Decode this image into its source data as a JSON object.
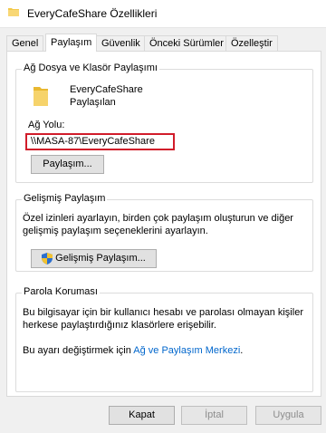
{
  "window": {
    "title": "EveryCafeShare Özellikleri",
    "icon": "folder-icon"
  },
  "tabs": [
    {
      "label": "Genel",
      "active": false
    },
    {
      "label": "Paylaşım",
      "active": true
    },
    {
      "label": "Güvenlik",
      "active": false
    },
    {
      "label": "Önceki Sürümler",
      "active": false
    },
    {
      "label": "Özelleştir",
      "active": false
    }
  ],
  "network_sharing": {
    "legend": "Ağ Dosya ve Klasör Paylaşımı",
    "folder_name": "EveryCafeShare",
    "status": "Paylaşılan",
    "path_label": "Ağ Yolu:",
    "path_value": "\\\\MASA-87\\EveryCafeShare",
    "share_button": "Paylaşım..."
  },
  "advanced_sharing": {
    "legend": "Gelişmiş Paylaşım",
    "description": "Özel izinleri ayarlayın, birden çok paylaşım oluşturun ve diğer gelişmiş paylaşım seçeneklerini ayarlayın.",
    "button": "Gelişmiş Paylaşım..."
  },
  "password_protection": {
    "legend": "Parola Koruması",
    "description": "Bu bilgisayar için bir kullanıcı hesabı ve parolası olmayan kişiler herkese paylaştırdığınız klasörlere erişebilir.",
    "change_prefix": "Bu ayarı değiştirmek için ",
    "link": "Ağ ve Paylaşım Merkezi",
    "change_suffix": "."
  },
  "footer": {
    "ok": "Kapat",
    "cancel": "İptal",
    "apply": "Uygula"
  },
  "colors": {
    "highlight_border": "#d11c2a",
    "link": "#0066cc",
    "folder": "#f3c94a"
  }
}
